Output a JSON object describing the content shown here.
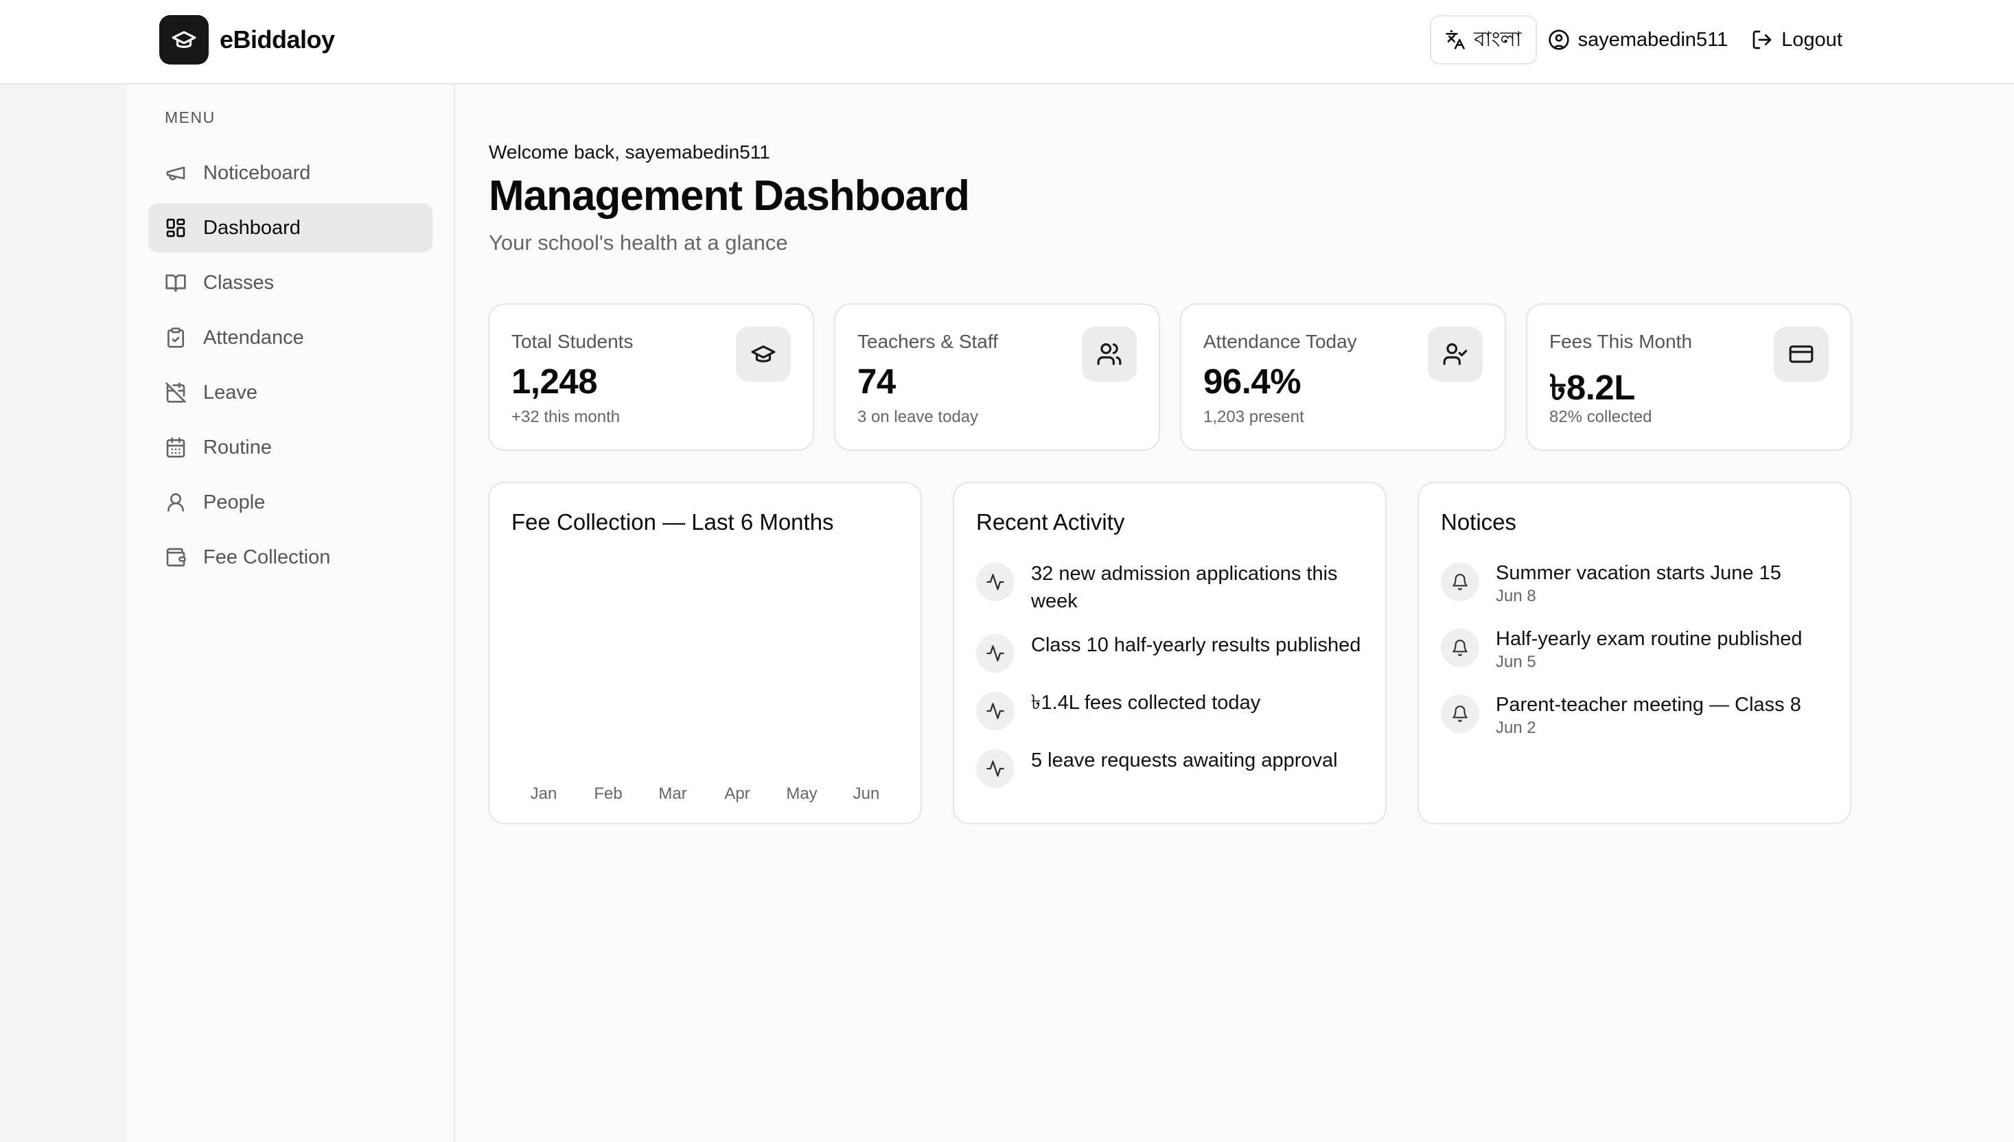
{
  "app": {
    "name": "eBiddaloy"
  },
  "header": {
    "language_label": "বাংলা",
    "username": "sayemabedin511",
    "logout_label": "Logout"
  },
  "sidebar": {
    "menu_label": "MENU",
    "items": [
      {
        "label": "Noticeboard",
        "icon": "megaphone-icon"
      },
      {
        "label": "Dashboard",
        "icon": "dashboard-icon",
        "active": true
      },
      {
        "label": "Classes",
        "icon": "book-icon"
      },
      {
        "label": "Attendance",
        "icon": "clipboard-check-icon"
      },
      {
        "label": "Leave",
        "icon": "calendar-off-icon"
      },
      {
        "label": "Routine",
        "icon": "calendar-icon"
      },
      {
        "label": "People",
        "icon": "user-icon"
      },
      {
        "label": "Fee Collection",
        "icon": "wallet-icon"
      }
    ]
  },
  "main": {
    "welcome": "Welcome back, sayemabedin511",
    "title": "Management Dashboard",
    "subtitle": "Your school's health at a glance"
  },
  "stats": [
    {
      "label": "Total Students",
      "value": "1,248",
      "sub": "+32 this month",
      "icon": "graduation-cap-icon"
    },
    {
      "label": "Teachers & Staff",
      "value": "74",
      "sub": "3 on leave today",
      "icon": "users-icon"
    },
    {
      "label": "Attendance Today",
      "value": "96.4%",
      "sub": "1,203 present",
      "icon": "user-check-icon"
    },
    {
      "label": "Fees This Month",
      "value": "৳8.2L",
      "sub": "82% collected",
      "icon": "credit-card-icon"
    }
  ],
  "fee_chart": {
    "title": "Fee Collection — Last 6 Months"
  },
  "chart_data": {
    "type": "bar",
    "categories": [
      "Jan",
      "Feb",
      "Mar",
      "Apr",
      "May",
      "Jun"
    ],
    "values": []
  },
  "activity": {
    "title": "Recent Activity",
    "items": [
      "32 new admission applications this week",
      "Class 10 half-yearly results published",
      "৳1.4L fees collected today",
      "5 leave requests awaiting approval"
    ]
  },
  "notices": {
    "title": "Notices",
    "items": [
      {
        "title": "Summer vacation starts June 15",
        "date": "Jun 8"
      },
      {
        "title": "Half-yearly exam routine published",
        "date": "Jun 5"
      },
      {
        "title": "Parent-teacher meeting — Class 8",
        "date": "Jun 2"
      }
    ]
  }
}
